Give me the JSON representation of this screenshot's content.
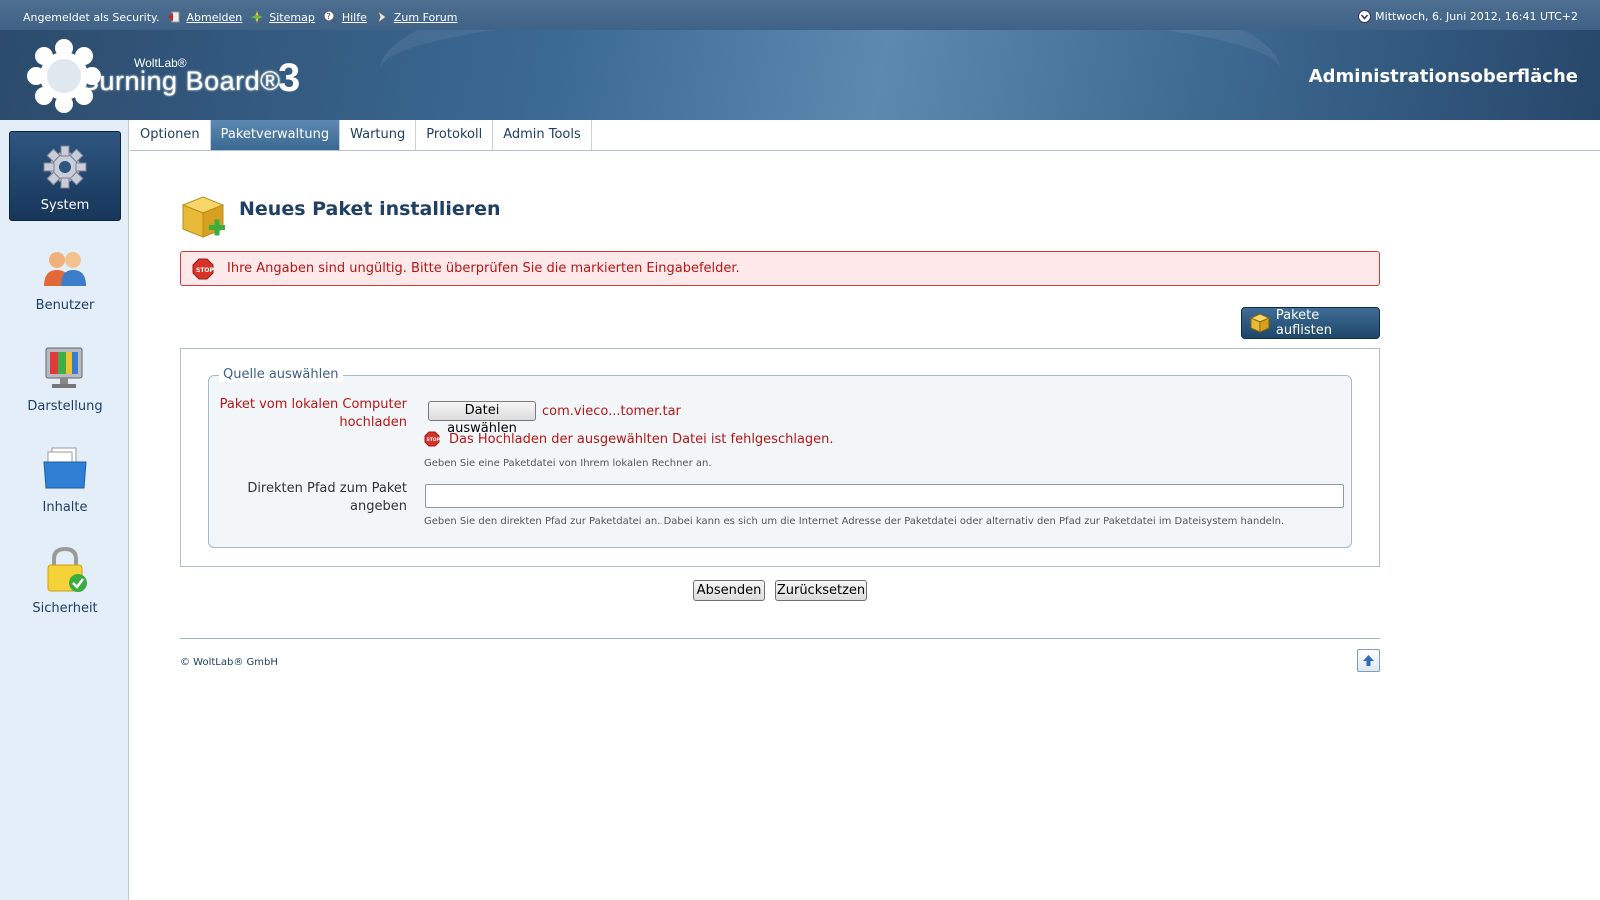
{
  "topbar": {
    "logged_in": "Angemeldet als Security.",
    "links": [
      {
        "label": "Abmelden",
        "icon": "logout-icon"
      },
      {
        "label": "Sitemap",
        "icon": "sitemap-icon"
      },
      {
        "label": "Hilfe",
        "icon": "help-icon"
      },
      {
        "label": "Zum Forum",
        "icon": "forum-icon"
      }
    ],
    "datetime": "Mittwoch, 6. Juni 2012, 16:41 UTC+2"
  },
  "header": {
    "logo_brand": "WoltLab®",
    "logo_product": "Burning Board®",
    "logo_version": "3",
    "admin_title": "Administrationsoberfläche"
  },
  "sidebar": {
    "items": [
      {
        "label": "System",
        "icon": "gear-icon",
        "active": true
      },
      {
        "label": "Benutzer",
        "icon": "users-icon",
        "active": false
      },
      {
        "label": "Darstellung",
        "icon": "monitor-icon",
        "active": false
      },
      {
        "label": "Inhalte",
        "icon": "folder-icon",
        "active": false
      },
      {
        "label": "Sicherheit",
        "icon": "lock-icon",
        "active": false
      }
    ]
  },
  "tabs": [
    {
      "label": "Optionen",
      "active": false
    },
    {
      "label": "Paketverwaltung",
      "active": true
    },
    {
      "label": "Wartung",
      "active": false
    },
    {
      "label": "Protokoll",
      "active": false
    },
    {
      "label": "Admin Tools",
      "active": false
    }
  ],
  "main": {
    "title": "Neues Paket installieren",
    "error_message": "Ihre Angaben sind ungültig. Bitte überprüfen Sie die markierten Eingabefelder.",
    "list_button": "Pakete auflisten",
    "fieldset_legend": "Quelle auswählen",
    "upload_label_line1": "Paket vom lokalen Computer",
    "upload_label_line2": "hochladen",
    "file_button": "Datei auswählen",
    "file_name": "com.vieco...tomer.tar",
    "upload_error": "Das Hochladen der ausgewählten Datei ist fehlgeschlagen.",
    "upload_hint": "Geben Sie eine Paketdatei von Ihrem lokalen Rechner an.",
    "path_label_line1": "Direkten Pfad zum Paket",
    "path_label_line2": "angeben",
    "path_value": "",
    "path_hint": "Geben Sie den direkten Pfad zur Paketdatei an. Dabei kann es sich um die Internet Adresse der Paketdatei oder alternativ den Pfad zur Paketdatei im Dateisystem handeln.",
    "submit_button": "Absenden",
    "reset_button": "Zurücksetzen"
  },
  "footer": {
    "copyright": "© WoltLab® GmbH"
  },
  "colors": {
    "brand_dark": "#1f3f63",
    "error_red": "#b41717",
    "error_bg": "#fde9ea"
  }
}
